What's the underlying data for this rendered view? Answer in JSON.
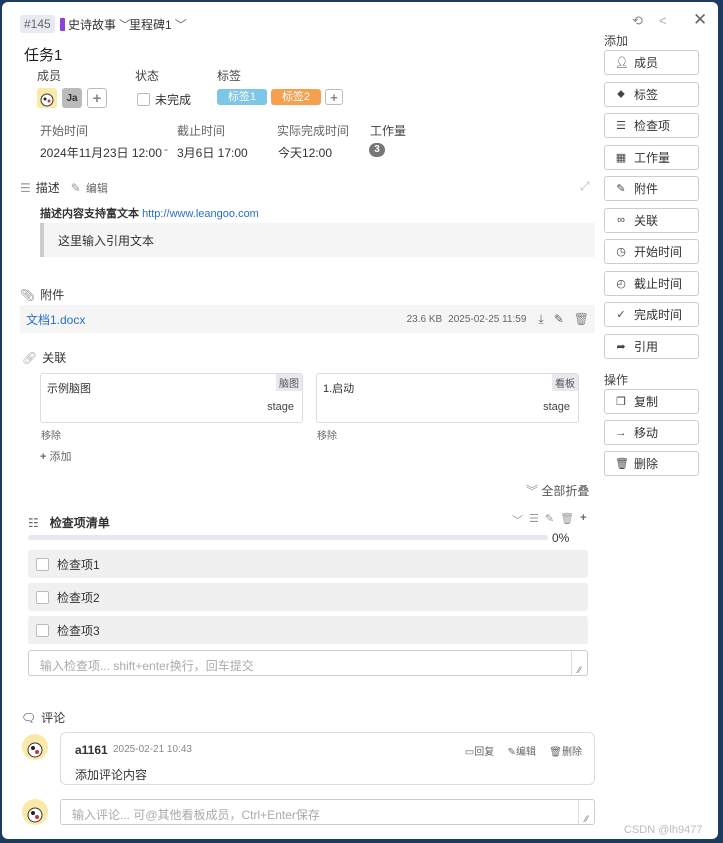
{
  "header": {
    "id": "#145",
    "epic": "史诗故事",
    "milestone": "里程碑1"
  },
  "task": {
    "title": "任务1"
  },
  "fields": {
    "members_label": "成员",
    "member_initials": "Ja",
    "status_label": "状态",
    "status_value": "未完成",
    "tags_label": "标签",
    "tags": [
      {
        "label": "标签1",
        "color": "#7ec5e6"
      },
      {
        "label": "标签2",
        "color": "#f5a04e"
      }
    ],
    "start_label": "开始时间",
    "start_value": "2024年11月23日 12:00",
    "due_label": "截止时间",
    "due_value": "3月6日 17:00",
    "separator": "-",
    "actual_label": "实际完成时间",
    "actual_value": "今天12:00",
    "workload_label": "工作量",
    "workload_value": "3"
  },
  "description": {
    "label": "描述",
    "edit_label": "编辑",
    "text": "描述内容支持富文本",
    "link": "http://www.leangoo.com",
    "quote": "这里输入引用文本"
  },
  "attachments": {
    "label": "附件",
    "items": [
      {
        "name": "文档1.docx",
        "size": "23.6 KB",
        "date": "2025-02-25 11:59"
      }
    ]
  },
  "relations": {
    "label": "关联",
    "items": [
      {
        "title": "示例脑图",
        "kind": "脑图",
        "stage": "stage",
        "remove": "移除"
      },
      {
        "title": "1.启动",
        "kind": "看板",
        "stage": "stage",
        "remove": "移除"
      }
    ],
    "add_label": "添加"
  },
  "collapse_all": "全部折叠",
  "checklist": {
    "title": "检查项清单",
    "progress_percent": 0,
    "progress_label": "0%",
    "items": [
      {
        "label": "检查项1",
        "checked": false
      },
      {
        "label": "检查项2",
        "checked": false
      },
      {
        "label": "检查项3",
        "checked": false
      }
    ],
    "placeholder": "输入检查项... shift+enter换行，回车提交"
  },
  "comments": {
    "label": "评论",
    "items": [
      {
        "author": "a1161",
        "time": "2025-02-21 10:43",
        "text": "添加评论内容",
        "reply": "回复",
        "edit": "编辑",
        "delete": "删除"
      }
    ],
    "placeholder": "输入评论... 可@其他看板成员，Ctrl+Enter保存"
  },
  "sidebar": {
    "add_label": "添加",
    "add_buttons": [
      "成员",
      "标签",
      "检查项",
      "工作量",
      "附件",
      "关联",
      "开始时间",
      "截止时间",
      "完成时间",
      "引用"
    ],
    "ops_label": "操作",
    "op_buttons": [
      "复制",
      "移动",
      "删除"
    ]
  },
  "watermark": "CSDN @lh9477"
}
